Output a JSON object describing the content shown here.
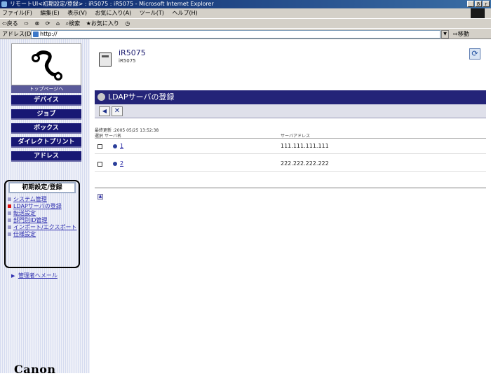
{
  "window": {
    "title": "リモートUI<初期設定/登録> : iR5075 : iR5075 - Microsoft Internet Explorer",
    "minimize": "_",
    "restore": "8",
    "close": "r"
  },
  "menubar": {
    "items": [
      "ファイル(F)",
      "編集(E)",
      "表示(V)",
      "お気に入り(A)",
      "ツール(T)",
      "ヘルプ(H)"
    ]
  },
  "toolbar": {
    "back": "⇦戻る",
    "forward": "⇨",
    "stop": "⊗",
    "refresh": "⟳",
    "home": "⌂",
    "search": "⌕検索",
    "favorites": "★お気に入り",
    "history": "◷"
  },
  "addressbar": {
    "label": "アドレス(D)",
    "url": "http://",
    "go": "⇨移動"
  },
  "sidebar": {
    "home_label": "トップページへ",
    "nav": [
      {
        "label": "デバイス"
      },
      {
        "label": "ジョブ"
      },
      {
        "label": "ボックス"
      },
      {
        "label": "ダイレクトプリント"
      },
      {
        "label": "アドレス"
      }
    ],
    "init_label": "初期設定/登録",
    "subnav": [
      {
        "label": "システム管理",
        "active": false
      },
      {
        "label": "LDAPサーバの登録",
        "active": true
      },
      {
        "label": "転送設定",
        "active": false
      },
      {
        "label": "部門別ID管理",
        "active": false
      },
      {
        "label": "インポート/エクスポート",
        "active": false
      },
      {
        "label": "仕様設定",
        "active": false
      }
    ],
    "admin_mail": "管理者へメール",
    "brand": "Canon"
  },
  "main": {
    "device_name": "iR5075",
    "device_sub": "iR5075",
    "section_title": "LDAPサーバの登録",
    "updated_label": "最終更新 :2005 05/25 13:52:38",
    "col_select": "選択",
    "col_server": "サーバ名",
    "col_address": "サーバアドレス",
    "servers": [
      {
        "name": "1",
        "address": "111.111.111.111"
      },
      {
        "name": "2",
        "address": "222.222.222.222"
      }
    ]
  },
  "colors": {
    "nav_bg": "#181874",
    "section_bar": "#242478",
    "active_bullet": "#e01010",
    "link": "#3030b0"
  }
}
